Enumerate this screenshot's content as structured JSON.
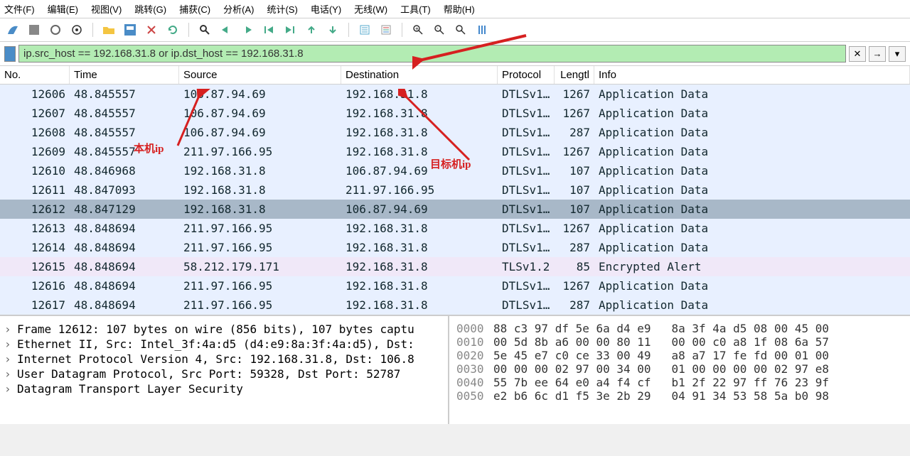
{
  "menu": [
    "文件(F)",
    "编辑(E)",
    "视图(V)",
    "跳转(G)",
    "捕获(C)",
    "分析(A)",
    "统计(S)",
    "电话(Y)",
    "无线(W)",
    "工具(T)",
    "帮助(H)"
  ],
  "filter": {
    "value": "ip.src_host == 192.168.31.8 or ip.dst_host == 192.168.31.8"
  },
  "columns": {
    "no": "No.",
    "time": "Time",
    "source": "Source",
    "destination": "Destination",
    "protocol": "Protocol",
    "length": "Lengtl",
    "info": "Info"
  },
  "packets": [
    {
      "no": "12606",
      "time": "48.845557",
      "src": "106.87.94.69",
      "dst": "192.168.31.8",
      "proto": "DTLSv1…",
      "len": "1267",
      "info": "Application Data",
      "cls": "normal"
    },
    {
      "no": "12607",
      "time": "48.845557",
      "src": "106.87.94.69",
      "dst": "192.168.31.8",
      "proto": "DTLSv1…",
      "len": "1267",
      "info": "Application Data",
      "cls": "normal"
    },
    {
      "no": "12608",
      "time": "48.845557",
      "src": "106.87.94.69",
      "dst": "192.168.31.8",
      "proto": "DTLSv1…",
      "len": "287",
      "info": "Application Data",
      "cls": "normal"
    },
    {
      "no": "12609",
      "time": "48.845557",
      "src": "211.97.166.95",
      "dst": "192.168.31.8",
      "proto": "DTLSv1…",
      "len": "1267",
      "info": "Application Data",
      "cls": "normal"
    },
    {
      "no": "12610",
      "time": "48.846968",
      "src": "192.168.31.8",
      "dst": "106.87.94.69",
      "proto": "DTLSv1…",
      "len": "107",
      "info": "Application Data",
      "cls": "normal"
    },
    {
      "no": "12611",
      "time": "48.847093",
      "src": "192.168.31.8",
      "dst": "211.97.166.95",
      "proto": "DTLSv1…",
      "len": "107",
      "info": "Application Data",
      "cls": "normal"
    },
    {
      "no": "12612",
      "time": "48.847129",
      "src": "192.168.31.8",
      "dst": "106.87.94.69",
      "proto": "DTLSv1…",
      "len": "107",
      "info": "Application Data",
      "cls": "selected"
    },
    {
      "no": "12613",
      "time": "48.848694",
      "src": "211.97.166.95",
      "dst": "192.168.31.8",
      "proto": "DTLSv1…",
      "len": "1267",
      "info": "Application Data",
      "cls": "normal"
    },
    {
      "no": "12614",
      "time": "48.848694",
      "src": "211.97.166.95",
      "dst": "192.168.31.8",
      "proto": "DTLSv1…",
      "len": "287",
      "info": "Application Data",
      "cls": "normal"
    },
    {
      "no": "12615",
      "time": "48.848694",
      "src": "58.212.179.171",
      "dst": "192.168.31.8",
      "proto": "TLSv1.2",
      "len": "85",
      "info": "Encrypted Alert",
      "cls": "tls"
    },
    {
      "no": "12616",
      "time": "48.848694",
      "src": "211.97.166.95",
      "dst": "192.168.31.8",
      "proto": "DTLSv1…",
      "len": "1267",
      "info": "Application Data",
      "cls": "normal"
    },
    {
      "no": "12617",
      "time": "48.848694",
      "src": "211.97.166.95",
      "dst": "192.168.31.8",
      "proto": "DTLSv1…",
      "len": "287",
      "info": "Application Data",
      "cls": "normal"
    }
  ],
  "tree": [
    "Frame 12612: 107 bytes on wire (856 bits), 107 bytes captu",
    "Ethernet II, Src: Intel_3f:4a:d5 (d4:e9:8a:3f:4a:d5), Dst:",
    "Internet Protocol Version 4, Src: 192.168.31.8, Dst: 106.8",
    "User Datagram Protocol, Src Port: 59328, Dst Port: 52787",
    "Datagram Transport Layer Security"
  ],
  "hex": [
    {
      "off": "0000",
      "b": "88 c3 97 df 5e 6a d4 e9   8a 3f 4a d5 08 00 45 00"
    },
    {
      "off": "0010",
      "b": "00 5d 8b a6 00 00 80 11   00 00 c0 a8 1f 08 6a 57"
    },
    {
      "off": "0020",
      "b": "5e 45 e7 c0 ce 33 00 49   a8 a7 17 fe fd 00 01 00"
    },
    {
      "off": "0030",
      "b": "00 00 00 02 97 00 34 00   01 00 00 00 00 02 97 e8"
    },
    {
      "off": "0040",
      "b": "55 7b ee 64 e0 a4 f4 cf   b1 2f 22 97 ff 76 23 9f"
    },
    {
      "off": "0050",
      "b": "e2 b6 6c d1 f5 3e 2b 29   04 91 34 53 58 5a b0 98"
    }
  ],
  "annotations": {
    "local_ip": "本机ip",
    "target_ip": "目标机ip"
  }
}
